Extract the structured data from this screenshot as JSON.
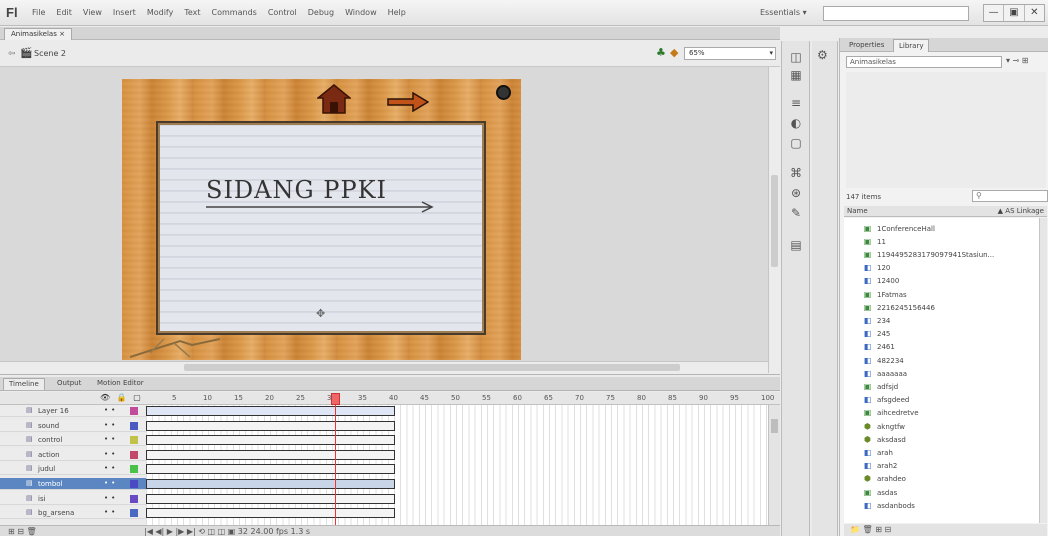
{
  "app": {
    "logo": "Fl"
  },
  "menu": [
    "File",
    "Edit",
    "View",
    "Insert",
    "Modify",
    "Text",
    "Commands",
    "Control",
    "Debug",
    "Window",
    "Help"
  ],
  "workspace_label": "Essentials ▾",
  "search_placeholder": "",
  "window_buttons": [
    "—",
    "▣",
    "✕"
  ],
  "document_tab": "Animasikelas ×",
  "scene_label": "Scene 2",
  "zoom_value": "65%",
  "stage": {
    "title": "SIDANG PPKI",
    "colors": {
      "wood": "#d8913e",
      "paper": "#e4e6ed",
      "home_roof": "#7a2a12",
      "arrow": "#c0521a"
    }
  },
  "panel": {
    "tabs": [
      "Properties",
      "Library"
    ],
    "library_select": "Animasikelas",
    "items_count": "147 items",
    "search_placeholder": "",
    "header_name": "Name",
    "header_linkage": "▲ AS Linkage",
    "items": [
      {
        "name": "1ConferenceHall",
        "icon": "bitmap-icon"
      },
      {
        "name": "11",
        "icon": "bitmap-icon"
      },
      {
        "name": "1194495283179097941Stasiun...",
        "icon": "bitmap-icon"
      },
      {
        "name": "120",
        "icon": "movieclip-icon"
      },
      {
        "name": "12400",
        "icon": "movieclip-icon"
      },
      {
        "name": "1Fatmas",
        "icon": "bitmap-icon"
      },
      {
        "name": "2216245156446",
        "icon": "bitmap-icon"
      },
      {
        "name": "234",
        "icon": "movieclip-icon"
      },
      {
        "name": "245",
        "icon": "movieclip-icon"
      },
      {
        "name": "2461",
        "icon": "movieclip-icon"
      },
      {
        "name": "482234",
        "icon": "movieclip-icon"
      },
      {
        "name": "aaaaaaa",
        "icon": "movieclip-icon"
      },
      {
        "name": "adfsjd",
        "icon": "bitmap-icon"
      },
      {
        "name": "afsgdeed",
        "icon": "movieclip-icon"
      },
      {
        "name": "aihcedretve",
        "icon": "bitmap-icon"
      },
      {
        "name": "akngtfw",
        "icon": "graphic-icon"
      },
      {
        "name": "aksdasd",
        "icon": "graphic-icon"
      },
      {
        "name": "arah",
        "icon": "movieclip-icon"
      },
      {
        "name": "arah2",
        "icon": "movieclip-icon"
      },
      {
        "name": "arahdeo",
        "icon": "graphic-icon"
      },
      {
        "name": "asdas",
        "icon": "bitmap-icon"
      },
      {
        "name": "asdanbods",
        "icon": "movieclip-icon"
      }
    ],
    "bottom_icons": "📁 🗑 ⊞ ⊟"
  },
  "timeline": {
    "tabs": [
      "Timeline",
      "Output",
      "Motion Editor"
    ],
    "header_icons": "👁 🔒 ▢",
    "frame_numbers": [
      "5",
      "10",
      "15",
      "20",
      "25",
      "30",
      "35",
      "40",
      "45",
      "50",
      "55",
      "60",
      "65",
      "70",
      "75",
      "80",
      "85",
      "90",
      "95",
      "100"
    ],
    "current_frame": "32",
    "layers": [
      {
        "name": "Layer 16",
        "color": "#c24a9a",
        "selected": false
      },
      {
        "name": "sound",
        "color": "#4a5ac2",
        "selected": false
      },
      {
        "name": "control",
        "color": "#c2c24a",
        "selected": false
      },
      {
        "name": "action",
        "color": "#c24a6a",
        "selected": false
      },
      {
        "name": "judul",
        "color": "#4ac24a",
        "selected": false
      },
      {
        "name": "tombol",
        "color": "#4a4ac2",
        "selected": true
      },
      {
        "name": "isi",
        "color": "#6a4ac2",
        "selected": false
      },
      {
        "name": "bg_arsena",
        "color": "#4a6ac2",
        "selected": false
      }
    ],
    "bottom_left": "⊞ ⊟ 🗑",
    "bottom_controls": "|◀ ◀| ▶ |▶ ▶| ⟲ ◫ ◫ ▣  32  24.00 fps  1.3 s"
  }
}
